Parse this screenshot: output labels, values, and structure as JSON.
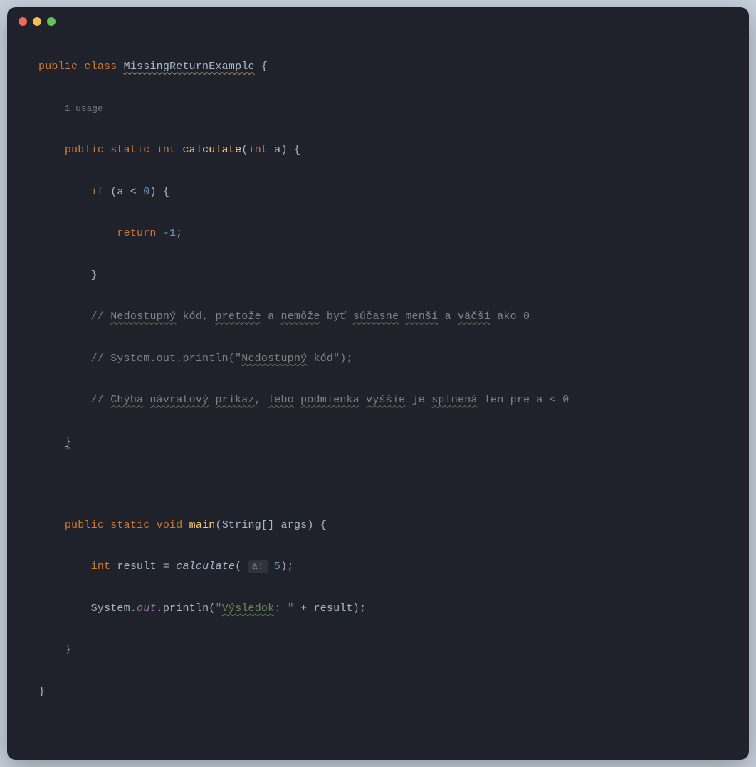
{
  "titlebar": {
    "red": "close",
    "yellow": "minimize",
    "green": "zoom"
  },
  "code": {
    "kw_public": "public",
    "kw_class": "class",
    "kw_static": "static",
    "kw_int": "int",
    "kw_void": "void",
    "kw_if": "if",
    "kw_return": "return",
    "class_name": "MissingReturnExample",
    "usage_hint": "1 usage",
    "method_calculate": "calculate",
    "method_main": "main",
    "param_a": "int a",
    "cond": "a < 0",
    "ret_val": "-1",
    "comment1_pre": "// ",
    "comment1_w1": "Nedostupný",
    "comment1_t1": " kód, ",
    "comment1_w2": "pretože",
    "comment1_t2": " a ",
    "comment1_w3": "nemôže",
    "comment1_t3": " byť ",
    "comment1_w4": "súčasne",
    "comment1_t4": " ",
    "comment1_w5": "menší",
    "comment1_t5": " a ",
    "comment1_w6": "väčší",
    "comment1_t6": " ako 0",
    "comment2_pre": "// System.out.println(\"",
    "comment2_w1": "Nedostupný",
    "comment2_suf": " kód\");",
    "comment3_pre": "// ",
    "comment3_w1": "Chýba",
    "comment3_t1": " ",
    "comment3_w2": "návratový",
    "comment3_t2": " ",
    "comment3_w3": "príkaz",
    "comment3_t3": ", ",
    "comment3_w4": "lebo",
    "comment3_t4": " ",
    "comment3_w5": "podmienka",
    "comment3_t5": " ",
    "comment3_w6": "vyššie",
    "comment3_t6": " je ",
    "comment3_w7": "splnená",
    "comment3_t7": " len pre a < 0",
    "main_args": "String[] args",
    "result_var": "result",
    "param_hint": "a:",
    "call_arg": "5",
    "out": "out",
    "println": "println",
    "system": "System",
    "str_vysledok_pre": "\"",
    "str_vysledok_w": "Výsledok",
    "str_vysledok_suf": ": \"",
    "plus": " + ",
    "semi": ";",
    "brace_open": " {",
    "brace_close": "}",
    "paren_open": "(",
    "paren_close": ")",
    "eq": " = ",
    "dot": "."
  }
}
